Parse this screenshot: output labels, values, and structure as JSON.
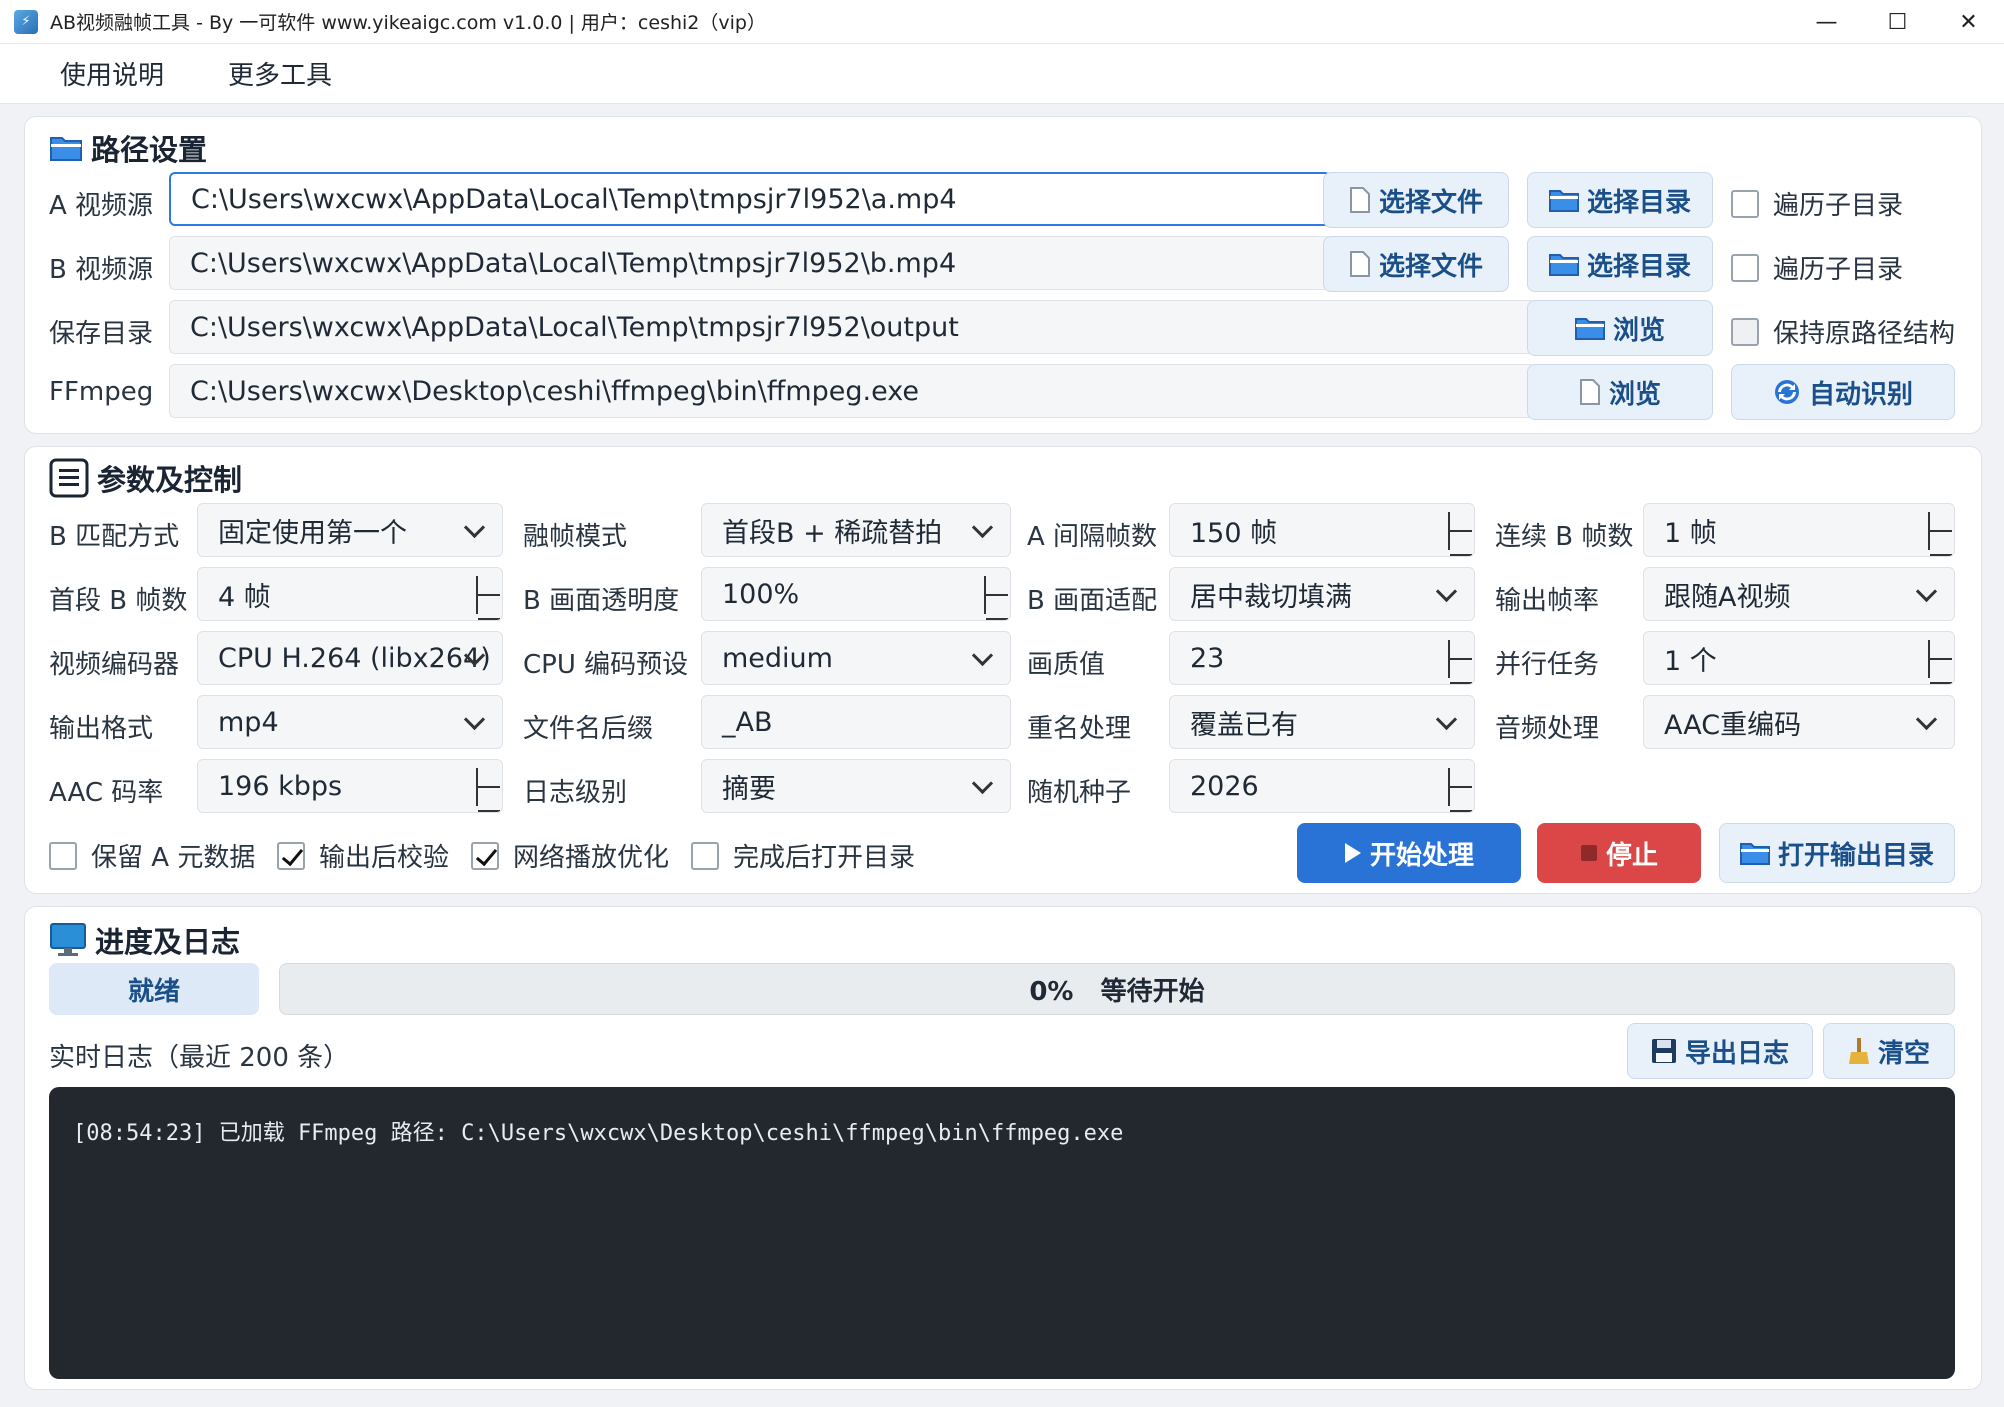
{
  "window": {
    "title": "AB视频融帧工具 - By 一可软件 www.yikeaigc.com  v1.0.0    |    用户：ceshi2（vip）",
    "minimize": "—",
    "maximize": "☐",
    "close": "✕"
  },
  "menu": [
    "使用说明",
    "更多工具"
  ],
  "paths": {
    "title": "路径设置",
    "a_label": "A 视频源",
    "a_value": "C:\\Users\\wxcwx\\AppData\\Local\\Temp\\tmpsjr7l952\\a.mp4",
    "b_label": "B 视频源",
    "b_value": "C:\\Users\\wxcwx\\AppData\\Local\\Temp\\tmpsjr7l952\\b.mp4",
    "save_label": "保存目录",
    "save_value": "C:\\Users\\wxcwx\\AppData\\Local\\Temp\\tmpsjr7l952\\output",
    "ffmpeg_label": "FFmpeg",
    "ffmpeg_value": "C:\\Users\\wxcwx\\Desktop\\ceshi\\ffmpeg\\bin\\ffmpeg.exe",
    "choose_file": "选择文件",
    "choose_dir": "选择目录",
    "recurse": "遍历子目录",
    "browse": "浏览",
    "keep_structure": "保持原路径结构",
    "auto_detect": "自动识别"
  },
  "params": {
    "title": "参数及控制",
    "b_match_label": "B 匹配方式",
    "b_match_value": "固定使用第一个",
    "blend_mode_label": "融帧模式",
    "blend_mode_value": "首段B + 稀疏替拍",
    "a_interval_label": "A 间隔帧数",
    "a_interval_value": "150 帧",
    "b_consecutive_label": "连续 B 帧数",
    "b_consecutive_value": "1 帧",
    "b_first_label": "首段 B 帧数",
    "b_first_value": "4 帧",
    "b_opacity_label": "B 画面透明度",
    "b_opacity_value": "100%",
    "b_fit_label": "B 画面适配",
    "b_fit_value": "居中裁切填满",
    "fps_label": "输出帧率",
    "fps_value": "跟随A视频",
    "encoder_label": "视频编码器",
    "encoder_value": "CPU H.264 (libx264)",
    "preset_label": "CPU 编码预设",
    "preset_value": "medium",
    "quality_label": "画质值",
    "quality_value": "23",
    "parallel_label": "并行任务",
    "parallel_value": "1 个",
    "format_label": "输出格式",
    "format_value": "mp4",
    "suffix_label": "文件名后缀",
    "suffix_value": "_AB",
    "rename_label": "重名处理",
    "rename_value": "覆盖已有",
    "audio_label": "音频处理",
    "audio_value": "AAC重编码",
    "aac_label": "AAC 码率",
    "aac_value": "196 kbps",
    "log_level_label": "日志级别",
    "log_level_value": "摘要",
    "seed_label": "随机种子",
    "seed_value": "2026",
    "keep_meta": "保留 A 元数据",
    "verify": "输出后校验",
    "faststart": "网络播放优化",
    "open_after": "完成后打开目录",
    "start": "开始处理",
    "stop": "停止",
    "open_output": "打开输出目录"
  },
  "progress": {
    "title": "进度及日志",
    "status": "就绪",
    "percent": "0%",
    "state": "等待开始",
    "fraction": 0,
    "log_title": "实时日志（最近 200 条）",
    "export": "导出日志",
    "clear": "清空",
    "log_line": "[08:54:23] 已加载 FFmpeg 路径: C:\\Users\\wxcwx\\Desktop\\ceshi\\ffmpeg\\bin\\ffmpeg.exe"
  },
  "colors": {
    "accent": "#2a73d6",
    "danger": "#db4646",
    "console_bg": "#23272e"
  }
}
